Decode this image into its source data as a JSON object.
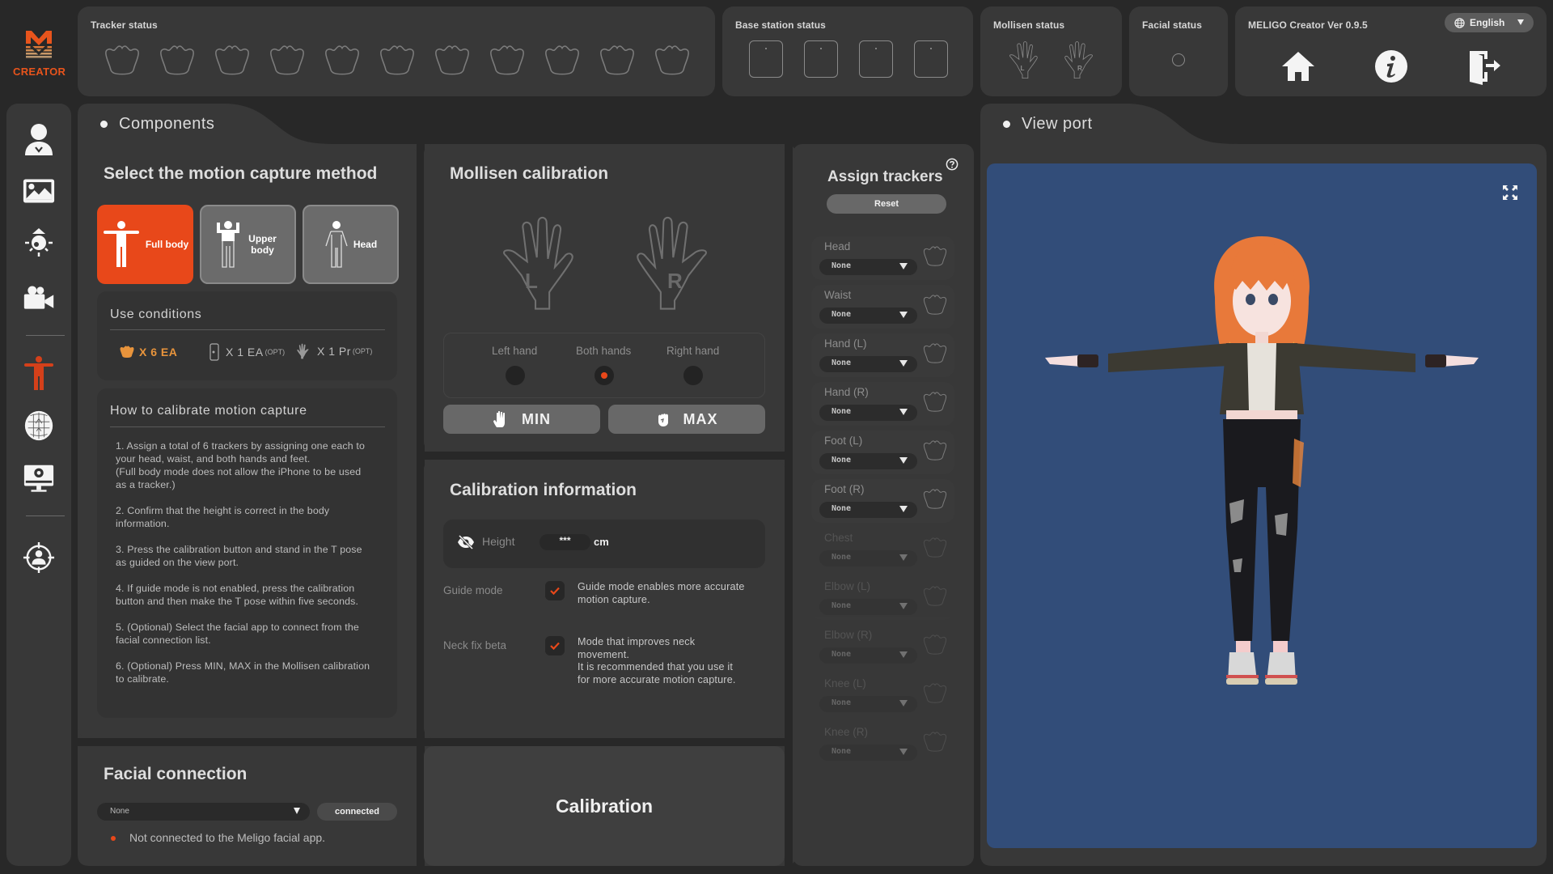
{
  "app": {
    "logo_text": "CREATOR",
    "version_label": "MELIGO Creator Ver 0.9.5",
    "language": "English",
    "accent_color": "#e8481a",
    "viewport_bg": "#324d79"
  },
  "sidebar": {
    "items": [
      {
        "icon": "avatar-user-icon",
        "active": false
      },
      {
        "icon": "background-image-icon",
        "active": false
      },
      {
        "icon": "lighting-lamp-icon",
        "active": false
      },
      {
        "icon": "video-camera-icon",
        "active": false
      },
      {
        "icon": "motion-capture-body-icon",
        "active": true
      },
      {
        "icon": "face-mesh-icon",
        "active": false
      },
      {
        "icon": "monitor-settings-icon",
        "active": false
      },
      {
        "icon": "avatar-target-icon",
        "active": false
      }
    ]
  },
  "status_bar": {
    "tracker_status": {
      "title": "Tracker status",
      "tracker_count": 11
    },
    "base_station_status": {
      "title": "Base station status",
      "station_count": 4
    },
    "mollisen_status": {
      "title": "Mollisen status",
      "hands": [
        "L",
        "R"
      ]
    },
    "facial_status": {
      "title": "Facial status"
    },
    "actions": [
      "home-icon",
      "info-icon",
      "exit-icon"
    ]
  },
  "components": {
    "tab_label": "Components",
    "method": {
      "title": "Select the motion capture method",
      "options": [
        {
          "label": "Full body",
          "selected": true
        },
        {
          "label": "Upper body",
          "selected": false
        },
        {
          "label": "Head",
          "selected": false
        }
      ]
    },
    "use_conditions": {
      "title": "Use conditions",
      "trackers": "X 6 EA",
      "phone": "X 1 EA",
      "phone_note": "(OPT)",
      "glove": "X 1 Pr",
      "glove_note": "(OPT)"
    },
    "how_to": {
      "title": "How to calibrate motion capture",
      "steps": [
        "1. Assign a total of 6 trackers by assigning one each to your head, waist, and both hands and feet.\n(Full body mode does not allow the iPhone to be used as a tracker.)",
        "2. Confirm that the height is correct in the body information.",
        "3. Press the calibration button and stand in the T pose as guided on the view port.",
        "4. If guide mode is not enabled, press the calibration button and then make the T pose within five seconds.",
        "5. (Optional) Select the facial app to connect from the facial connection list.",
        "6. (Optional) Press MIN, MAX in the Mollisen calibration to calibrate."
      ]
    },
    "facial_connection": {
      "title": "Facial connection",
      "selected": "None",
      "connect_button": "connected",
      "status_text": "Not connected to the Meligo facial app."
    },
    "mollisen": {
      "title": "Mollisen calibration",
      "hand_labels": [
        "L",
        "R"
      ],
      "hand_options": [
        {
          "label": "Left hand",
          "selected": false
        },
        {
          "label": "Both hands",
          "selected": true
        },
        {
          "label": "Right hand",
          "selected": false
        }
      ],
      "min_label": "MIN",
      "max_label": "MAX"
    },
    "calibration_info": {
      "title": "Calibration information",
      "height_label": "Height",
      "height_value": "***",
      "height_unit": "cm",
      "guide_mode": {
        "label": "Guide mode",
        "checked": true,
        "description": "Guide mode enables more accurate\nmotion capture."
      },
      "neck_fix": {
        "label": "Neck fix beta",
        "checked": true,
        "description": "Mode that improves neck\nmovement.\nIt is recommended that you use it\nfor more accurate motion capture."
      }
    },
    "calibration_button": "Calibration",
    "assign_trackers": {
      "title": "Assign trackers",
      "reset_label": "Reset",
      "rows": [
        {
          "label": "Head",
          "value": "None",
          "enabled": true
        },
        {
          "label": "Waist",
          "value": "None",
          "enabled": true
        },
        {
          "label": "Hand (L)",
          "value": "None",
          "enabled": true
        },
        {
          "label": "Hand (R)",
          "value": "None",
          "enabled": true
        },
        {
          "label": "Foot (L)",
          "value": "None",
          "enabled": true
        },
        {
          "label": "Foot (R)",
          "value": "None",
          "enabled": true
        },
        {
          "label": "Chest",
          "value": "None",
          "enabled": false
        },
        {
          "label": "Elbow (L)",
          "value": "None",
          "enabled": false
        },
        {
          "label": "Elbow (R)",
          "value": "None",
          "enabled": false
        },
        {
          "label": "Knee (L)",
          "value": "None",
          "enabled": false
        },
        {
          "label": "Knee (R)",
          "value": "None",
          "enabled": false
        }
      ]
    }
  },
  "viewport": {
    "tab_label": "View port",
    "avatar": "T-pose anime avatar with orange hair, dark jacket, ripped black jeans, white sneakers"
  }
}
